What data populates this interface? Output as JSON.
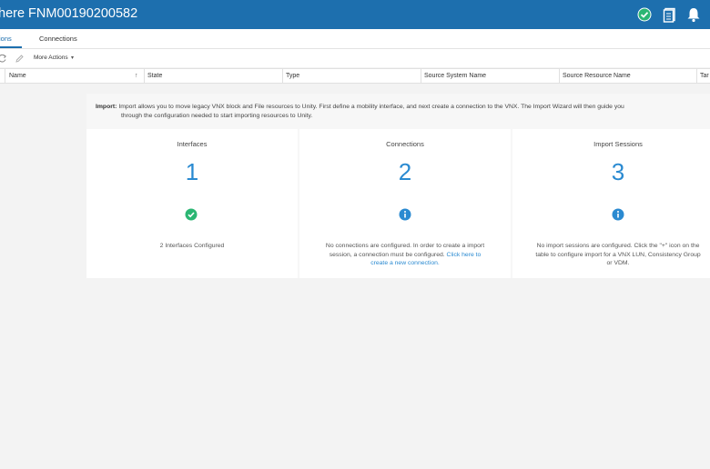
{
  "header": {
    "title": "here FNM00190200582"
  },
  "tabs": [
    {
      "label": "ions"
    },
    {
      "label": "Connections"
    }
  ],
  "toolbar": {
    "more_actions_label": "More Actions",
    "caret": "▾"
  },
  "table": {
    "columns": [
      "Name",
      "State",
      "Type",
      "Source System Name",
      "Source Resource Name",
      "Tar"
    ],
    "sort_indicator": "↑"
  },
  "import_info": {
    "label": "Import:",
    "line1": "Import allows you to move legacy VNX block and File resources to Unity. First define a mobility interface, and next create a connection to the VNX. The Import Wizard will then guide you",
    "line2": "through the configuration needed to start importing resources to Unity."
  },
  "cards": [
    {
      "title": "Interfaces",
      "number": "1",
      "status_icon": "check-circle-icon",
      "text": "2 Interfaces Configured"
    },
    {
      "title": "Connections",
      "number": "2",
      "status_icon": "info-circle-icon",
      "text_line1": "No connections are configured. In order to create a import",
      "text_line2_prefix": "session, a connection must be configured.",
      "link_part1": "Click here to",
      "link_part2": "create a new connection."
    },
    {
      "title": "Import Sessions",
      "number": "3",
      "status_icon": "info-circle-icon",
      "text_line1": "No import sessions are configured. Click the \"+\" icon on the",
      "text_line2": "table to configure import for a VNX LUN, Consistency Group",
      "text_line3": "or VDM."
    }
  ],
  "colors": {
    "header_bg": "#1d6fae",
    "accent": "#2a8ad1",
    "success": "#2bb673"
  }
}
